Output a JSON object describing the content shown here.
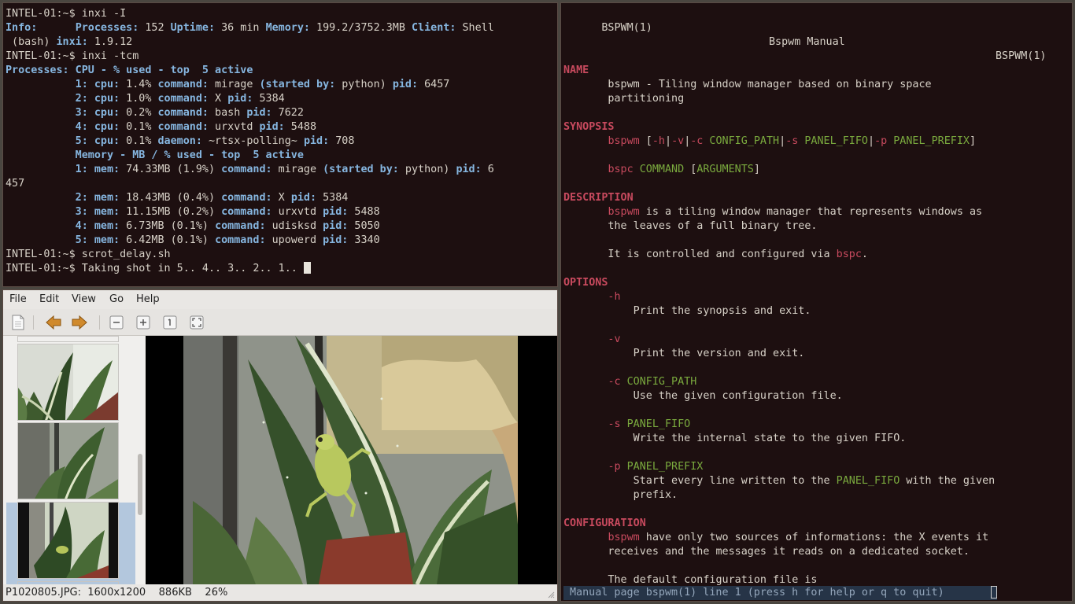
{
  "terminal": {
    "line1": {
      "prompt": "INTEL-01:~$ ",
      "cmd": "inxi -I"
    },
    "info": {
      "label": "Info:",
      "pad": "      ",
      "processes_label": "Processes:",
      "processes_value": " 152 ",
      "uptime_label": "Uptime:",
      "uptime_value": " 36 min ",
      "memory_label": "Memory:",
      "memory_value": " 199.2/3752.3MB ",
      "client_label": "Client:",
      "client_value": " Shell"
    },
    "info2": {
      "pre": " (bash) ",
      "inxi_label": "inxi:",
      "inxi_value": " 1.9.12"
    },
    "line3": {
      "prompt": "INTEL-01:~$ ",
      "cmd": "inxi -tcm"
    },
    "proc_header": {
      "label": "Processes:",
      "title": " CPU - % used - top  5 active"
    },
    "cpu": [
      {
        "n": "           1:",
        "cpu": " cpu:",
        "cpu_v": " 1.4% ",
        "cmd": "command:",
        "cmd_v": " mirage ",
        "sb": "(started by:",
        "sb_v": " python) ",
        "pid": "pid:",
        "pid_v": " 6457"
      },
      {
        "n": "           2:",
        "cpu": " cpu:",
        "cpu_v": " 1.0% ",
        "cmd": "command:",
        "cmd_v": " X ",
        "pid": "pid:",
        "pid_v": " 5384"
      },
      {
        "n": "           3:",
        "cpu": " cpu:",
        "cpu_v": " 0.2% ",
        "cmd": "command:",
        "cmd_v": " bash ",
        "pid": "pid:",
        "pid_v": " 7622"
      },
      {
        "n": "           4:",
        "cpu": " cpu:",
        "cpu_v": " 0.1% ",
        "cmd": "command:",
        "cmd_v": " urxvtd ",
        "pid": "pid:",
        "pid_v": " 5488"
      },
      {
        "n": "           5:",
        "cpu": " cpu:",
        "cpu_v": " 0.1% ",
        "cmd": "daemon:",
        "cmd_v": " ~rtsx-polling~ ",
        "pid": "pid:",
        "pid_v": " 708"
      }
    ],
    "mem_header": "           Memory - MB / % used - top  5 active",
    "mem": [
      {
        "n": "           1:",
        "mem": " mem:",
        "mem_v": " 74.33MB (1.9%) ",
        "cmd": "command:",
        "cmd_v": " mirage ",
        "sb": "(started by:",
        "sb_v": " python) ",
        "pid": "pid:",
        "pid_v": " 6",
        "wrap": "457"
      },
      {
        "n": "           2:",
        "mem": " mem:",
        "mem_v": " 18.43MB (0.4%) ",
        "cmd": "command:",
        "cmd_v": " X ",
        "pid": "pid:",
        "pid_v": " 5384"
      },
      {
        "n": "           3:",
        "mem": " mem:",
        "mem_v": " 11.15MB (0.2%) ",
        "cmd": "command:",
        "cmd_v": " urxvtd ",
        "pid": "pid:",
        "pid_v": " 5488"
      },
      {
        "n": "           4:",
        "mem": " mem:",
        "mem_v": " 6.73MB (0.1%) ",
        "cmd": "command:",
        "cmd_v": " udisksd ",
        "pid": "pid:",
        "pid_v": " 5050"
      },
      {
        "n": "           5:",
        "mem": " mem:",
        "mem_v": " 6.42MB (0.1%) ",
        "cmd": "command:",
        "cmd_v": " upowerd ",
        "pid": "pid:",
        "pid_v": " 3340"
      }
    ],
    "line_scrot": {
      "prompt": "INTEL-01:~$ ",
      "cmd": "scrot_delay.sh"
    },
    "line_last": {
      "prompt": "INTEL-01:~$ ",
      "cmd": "Taking shot in 5.. 4.. 3.. 2.. 1.. "
    }
  },
  "man": {
    "header_left": "BSPWM(1)",
    "header_center": "Bspwm Manual",
    "header_right": "BSPWM(1)",
    "name_h": "NAME",
    "name_1": "       bspwm - Tiling window manager based on binary space",
    "name_2": "       partitioning",
    "synopsis_h": "SYNOPSIS",
    "syn1": {
      "pad": "       ",
      "a": "bspwm",
      "b": " [",
      "c": "-h",
      "d": "|",
      "e": "-v",
      "f": "|",
      "g": "-c",
      "h": " CONFIG_PATH",
      "i": "|",
      "j": "-s",
      "k": " PANEL_FIFO",
      "l": "|",
      "m": "-p",
      "n": " PANEL_PREFIX",
      "o": "]"
    },
    "syn2": {
      "pad": "       ",
      "a": "bspc",
      "b": " ",
      "c": "COMMAND",
      "d": " [",
      "e": "ARGUMENTS",
      "f": "]"
    },
    "description_h": "DESCRIPTION",
    "desc1": {
      "pad": "       ",
      "a": "bspwm",
      "b": " is a tiling window manager that represents windows as"
    },
    "desc2": "       the leaves of a full binary tree.",
    "desc3": {
      "pre": "       It is controlled and configured via ",
      "a": "bspc",
      "b": "."
    },
    "options_h": "OPTIONS",
    "opt_h": "       -h",
    "opt_h_d": "           Print the synopsis and exit.",
    "opt_v": "       -v",
    "opt_v_d": "           Print the version and exit.",
    "opt_c": {
      "pad": "       ",
      "a": "-c",
      "b": " CONFIG_PATH"
    },
    "opt_c_d": "           Use the given configuration file.",
    "opt_s": {
      "pad": "       ",
      "a": "-s",
      "b": " PANEL_FIFO"
    },
    "opt_s_d": "           Write the internal state to the given FIFO.",
    "opt_p": {
      "pad": "       ",
      "a": "-p",
      "b": " PANEL_PREFIX"
    },
    "opt_p_d1": {
      "pre": "           Start every line written to the ",
      "a": "PANEL_FIFO",
      "b": " with the given"
    },
    "opt_p_d2": "           prefix.",
    "config_h": "CONFIGURATION",
    "conf1": {
      "pad": "       ",
      "a": "bspwm",
      "b": " have only two sources of informations: the X events it"
    },
    "conf2": "       receives and the messages it reads on a dedicated socket.",
    "conf3": "       The default configuration file is",
    "status": "Manual page bspwm(1) line 1 (press h for help or q to quit)"
  },
  "viewer": {
    "menu": [
      "File",
      "Edit",
      "View",
      "Go",
      "Help"
    ],
    "toolbar_icons": [
      "new-file-icon",
      "back-arrow-icon",
      "forward-arrow-icon",
      "zoom-out-icon",
      "zoom-in-icon",
      "zoom-1to1-icon",
      "zoom-fit-icon"
    ],
    "status": "P1020805.JPG:  1600x1200    886KB    26%"
  }
}
